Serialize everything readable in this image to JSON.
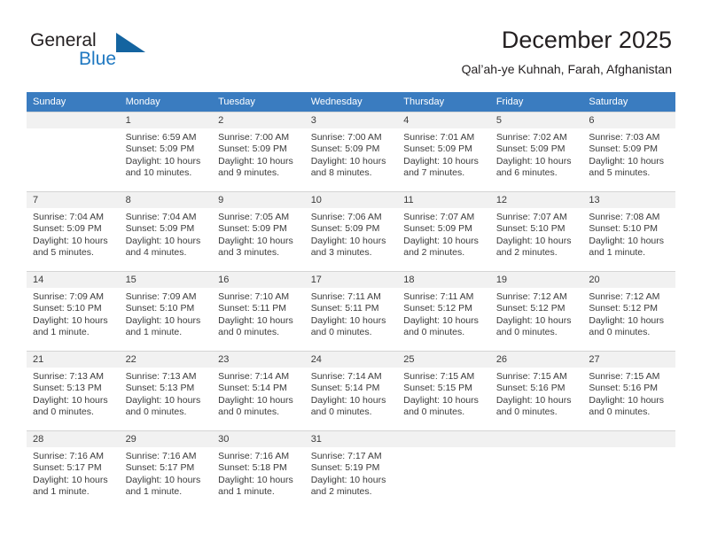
{
  "brand": {
    "name_part1": "General",
    "name_part2": "Blue",
    "logo_icon": "blue-triangle-icon"
  },
  "header": {
    "title": "December 2025",
    "subtitle": "Qal’ah-ye Kuhnah, Farah, Afghanistan"
  },
  "colors": {
    "header_row_bg": "#3a7cc0",
    "header_row_text": "#ffffff",
    "daynum_bg": "#f1f1f1",
    "brand_blue": "#1f78c1",
    "logo_blue": "#1464a0",
    "cell_border": "#d4d4d4",
    "body_text": "#3b3b3b"
  },
  "weekdays": [
    "Sunday",
    "Monday",
    "Tuesday",
    "Wednesday",
    "Thursday",
    "Friday",
    "Saturday"
  ],
  "weeks": [
    [
      {
        "day": "",
        "sunrise": "",
        "sunset": "",
        "daylight": "",
        "empty": true
      },
      {
        "day": "1",
        "sunrise": "Sunrise: 6:59 AM",
        "sunset": "Sunset: 5:09 PM",
        "daylight": "Daylight: 10 hours and 10 minutes."
      },
      {
        "day": "2",
        "sunrise": "Sunrise: 7:00 AM",
        "sunset": "Sunset: 5:09 PM",
        "daylight": "Daylight: 10 hours and 9 minutes."
      },
      {
        "day": "3",
        "sunrise": "Sunrise: 7:00 AM",
        "sunset": "Sunset: 5:09 PM",
        "daylight": "Daylight: 10 hours and 8 minutes."
      },
      {
        "day": "4",
        "sunrise": "Sunrise: 7:01 AM",
        "sunset": "Sunset: 5:09 PM",
        "daylight": "Daylight: 10 hours and 7 minutes."
      },
      {
        "day": "5",
        "sunrise": "Sunrise: 7:02 AM",
        "sunset": "Sunset: 5:09 PM",
        "daylight": "Daylight: 10 hours and 6 minutes."
      },
      {
        "day": "6",
        "sunrise": "Sunrise: 7:03 AM",
        "sunset": "Sunset: 5:09 PM",
        "daylight": "Daylight: 10 hours and 5 minutes."
      }
    ],
    [
      {
        "day": "7",
        "sunrise": "Sunrise: 7:04 AM",
        "sunset": "Sunset: 5:09 PM",
        "daylight": "Daylight: 10 hours and 5 minutes."
      },
      {
        "day": "8",
        "sunrise": "Sunrise: 7:04 AM",
        "sunset": "Sunset: 5:09 PM",
        "daylight": "Daylight: 10 hours and 4 minutes."
      },
      {
        "day": "9",
        "sunrise": "Sunrise: 7:05 AM",
        "sunset": "Sunset: 5:09 PM",
        "daylight": "Daylight: 10 hours and 3 minutes."
      },
      {
        "day": "10",
        "sunrise": "Sunrise: 7:06 AM",
        "sunset": "Sunset: 5:09 PM",
        "daylight": "Daylight: 10 hours and 3 minutes."
      },
      {
        "day": "11",
        "sunrise": "Sunrise: 7:07 AM",
        "sunset": "Sunset: 5:09 PM",
        "daylight": "Daylight: 10 hours and 2 minutes."
      },
      {
        "day": "12",
        "sunrise": "Sunrise: 7:07 AM",
        "sunset": "Sunset: 5:10 PM",
        "daylight": "Daylight: 10 hours and 2 minutes."
      },
      {
        "day": "13",
        "sunrise": "Sunrise: 7:08 AM",
        "sunset": "Sunset: 5:10 PM",
        "daylight": "Daylight: 10 hours and 1 minute."
      }
    ],
    [
      {
        "day": "14",
        "sunrise": "Sunrise: 7:09 AM",
        "sunset": "Sunset: 5:10 PM",
        "daylight": "Daylight: 10 hours and 1 minute."
      },
      {
        "day": "15",
        "sunrise": "Sunrise: 7:09 AM",
        "sunset": "Sunset: 5:10 PM",
        "daylight": "Daylight: 10 hours and 1 minute."
      },
      {
        "day": "16",
        "sunrise": "Sunrise: 7:10 AM",
        "sunset": "Sunset: 5:11 PM",
        "daylight": "Daylight: 10 hours and 0 minutes."
      },
      {
        "day": "17",
        "sunrise": "Sunrise: 7:11 AM",
        "sunset": "Sunset: 5:11 PM",
        "daylight": "Daylight: 10 hours and 0 minutes."
      },
      {
        "day": "18",
        "sunrise": "Sunrise: 7:11 AM",
        "sunset": "Sunset: 5:12 PM",
        "daylight": "Daylight: 10 hours and 0 minutes."
      },
      {
        "day": "19",
        "sunrise": "Sunrise: 7:12 AM",
        "sunset": "Sunset: 5:12 PM",
        "daylight": "Daylight: 10 hours and 0 minutes."
      },
      {
        "day": "20",
        "sunrise": "Sunrise: 7:12 AM",
        "sunset": "Sunset: 5:12 PM",
        "daylight": "Daylight: 10 hours and 0 minutes."
      }
    ],
    [
      {
        "day": "21",
        "sunrise": "Sunrise: 7:13 AM",
        "sunset": "Sunset: 5:13 PM",
        "daylight": "Daylight: 10 hours and 0 minutes."
      },
      {
        "day": "22",
        "sunrise": "Sunrise: 7:13 AM",
        "sunset": "Sunset: 5:13 PM",
        "daylight": "Daylight: 10 hours and 0 minutes."
      },
      {
        "day": "23",
        "sunrise": "Sunrise: 7:14 AM",
        "sunset": "Sunset: 5:14 PM",
        "daylight": "Daylight: 10 hours and 0 minutes."
      },
      {
        "day": "24",
        "sunrise": "Sunrise: 7:14 AM",
        "sunset": "Sunset: 5:14 PM",
        "daylight": "Daylight: 10 hours and 0 minutes."
      },
      {
        "day": "25",
        "sunrise": "Sunrise: 7:15 AM",
        "sunset": "Sunset: 5:15 PM",
        "daylight": "Daylight: 10 hours and 0 minutes."
      },
      {
        "day": "26",
        "sunrise": "Sunrise: 7:15 AM",
        "sunset": "Sunset: 5:16 PM",
        "daylight": "Daylight: 10 hours and 0 minutes."
      },
      {
        "day": "27",
        "sunrise": "Sunrise: 7:15 AM",
        "sunset": "Sunset: 5:16 PM",
        "daylight": "Daylight: 10 hours and 0 minutes."
      }
    ],
    [
      {
        "day": "28",
        "sunrise": "Sunrise: 7:16 AM",
        "sunset": "Sunset: 5:17 PM",
        "daylight": "Daylight: 10 hours and 1 minute."
      },
      {
        "day": "29",
        "sunrise": "Sunrise: 7:16 AM",
        "sunset": "Sunset: 5:17 PM",
        "daylight": "Daylight: 10 hours and 1 minute."
      },
      {
        "day": "30",
        "sunrise": "Sunrise: 7:16 AM",
        "sunset": "Sunset: 5:18 PM",
        "daylight": "Daylight: 10 hours and 1 minute."
      },
      {
        "day": "31",
        "sunrise": "Sunrise: 7:17 AM",
        "sunset": "Sunset: 5:19 PM",
        "daylight": "Daylight: 10 hours and 2 minutes."
      },
      {
        "day": "",
        "sunrise": "",
        "sunset": "",
        "daylight": "",
        "empty": true
      },
      {
        "day": "",
        "sunrise": "",
        "sunset": "",
        "daylight": "",
        "empty": true
      },
      {
        "day": "",
        "sunrise": "",
        "sunset": "",
        "daylight": "",
        "empty": true
      }
    ]
  ]
}
